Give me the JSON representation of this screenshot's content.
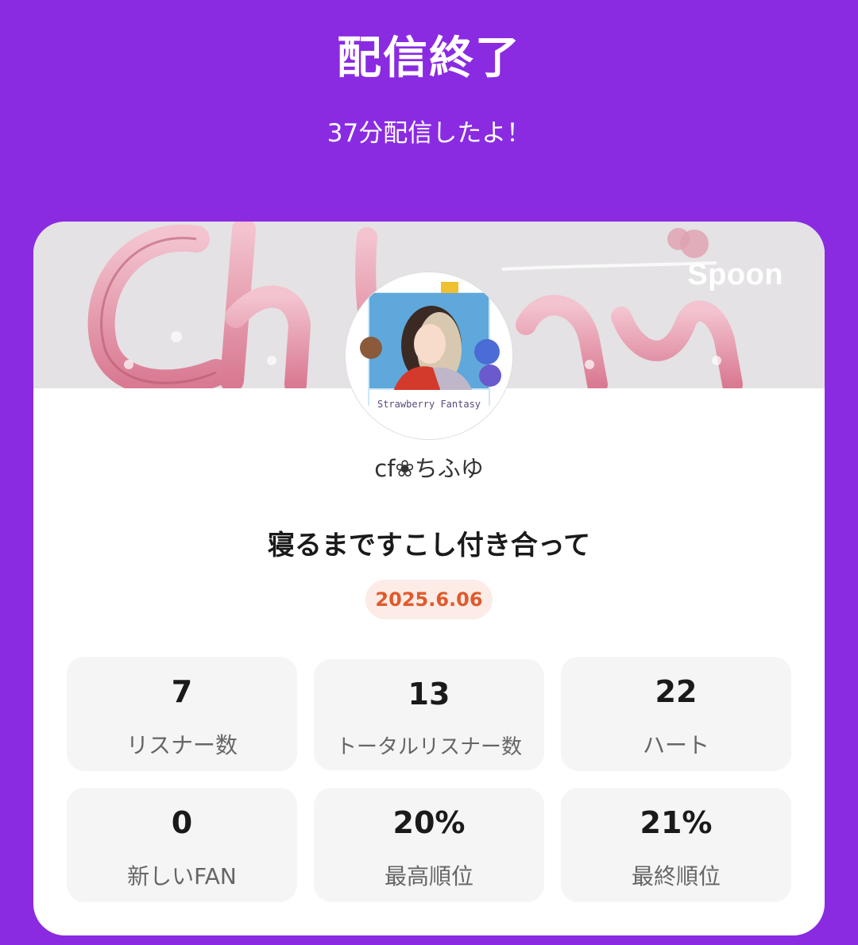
{
  "header": {
    "title": "配信終了",
    "subtitle": "37分配信したよ！"
  },
  "banner": {
    "brand_logo": "Spoon"
  },
  "profile": {
    "avatar_icon": "profile-avatar",
    "username": "cf❀ちふゆ"
  },
  "live": {
    "title": "寝るまですこし付き合って",
    "date": "2025.6.06"
  },
  "stats": [
    {
      "value": "7",
      "label": "リスナー数"
    },
    {
      "value": "13",
      "label": "トータルリスナー数"
    },
    {
      "value": "22",
      "label": "ハート"
    },
    {
      "value": "0",
      "label": "新しいFAN"
    },
    {
      "value": "20%",
      "label": "最高順位"
    },
    {
      "value": "21%",
      "label": "最終順位"
    }
  ],
  "colors": {
    "background": "#8a2be2",
    "card": "#ffffff",
    "date_text": "#e05a2c",
    "date_badge": "#fcebe6",
    "stat_tile": "#f5f5f5"
  }
}
